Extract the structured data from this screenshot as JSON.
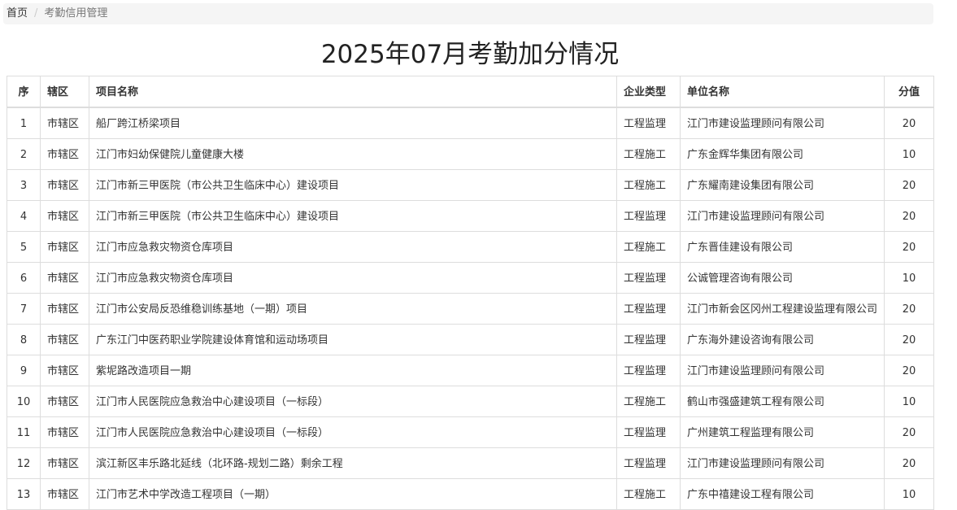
{
  "breadcrumb": {
    "home": "首页",
    "separator": "/",
    "current": "考勤信用管理"
  },
  "title": "2025年07月考勤加分情况",
  "table": {
    "headers": [
      "序",
      "辖区",
      "项目名称",
      "企业类型",
      "单位名称",
      "分值"
    ],
    "rows": [
      [
        "1",
        "市辖区",
        "船厂跨江桥梁项目",
        "工程监理",
        "江门市建设监理顾问有限公司",
        "20"
      ],
      [
        "2",
        "市辖区",
        "江门市妇幼保健院儿童健康大楼",
        "工程施工",
        "广东金辉华集团有限公司",
        "10"
      ],
      [
        "3",
        "市辖区",
        "江门市新三甲医院（市公共卫生临床中心）建设项目",
        "工程施工",
        "广东耀南建设集团有限公司",
        "20"
      ],
      [
        "4",
        "市辖区",
        "江门市新三甲医院（市公共卫生临床中心）建设项目",
        "工程监理",
        "江门市建设监理顾问有限公司",
        "20"
      ],
      [
        "5",
        "市辖区",
        "江门市应急救灾物资仓库项目",
        "工程施工",
        "广东晋佳建设有限公司",
        "20"
      ],
      [
        "6",
        "市辖区",
        "江门市应急救灾物资仓库项目",
        "工程监理",
        "公诚管理咨询有限公司",
        "10"
      ],
      [
        "7",
        "市辖区",
        "江门市公安局反恐维稳训练基地（一期）项目",
        "工程监理",
        "江门市新会区冈州工程建设监理有限公司",
        "20"
      ],
      [
        "8",
        "市辖区",
        "广东江门中医药职业学院建设体育馆和运动场项目",
        "工程监理",
        "广东海外建设咨询有限公司",
        "20"
      ],
      [
        "9",
        "市辖区",
        "紫坭路改造项目一期",
        "工程监理",
        "江门市建设监理顾问有限公司",
        "20"
      ],
      [
        "10",
        "市辖区",
        "江门市人民医院应急救治中心建设项目（一标段）",
        "工程施工",
        "鹤山市强盛建筑工程有限公司",
        "10"
      ],
      [
        "11",
        "市辖区",
        "江门市人民医院应急救治中心建设项目（一标段）",
        "工程监理",
        "广州建筑工程监理有限公司",
        "20"
      ],
      [
        "12",
        "市辖区",
        "滨江新区丰乐路北延线（北环路-规划二路）剩余工程",
        "工程监理",
        "江门市建设监理顾问有限公司",
        "20"
      ],
      [
        "13",
        "市辖区",
        "江门市艺术中学改造工程项目（一期）",
        "工程施工",
        "广东中禧建设工程有限公司",
        "10"
      ]
    ]
  }
}
